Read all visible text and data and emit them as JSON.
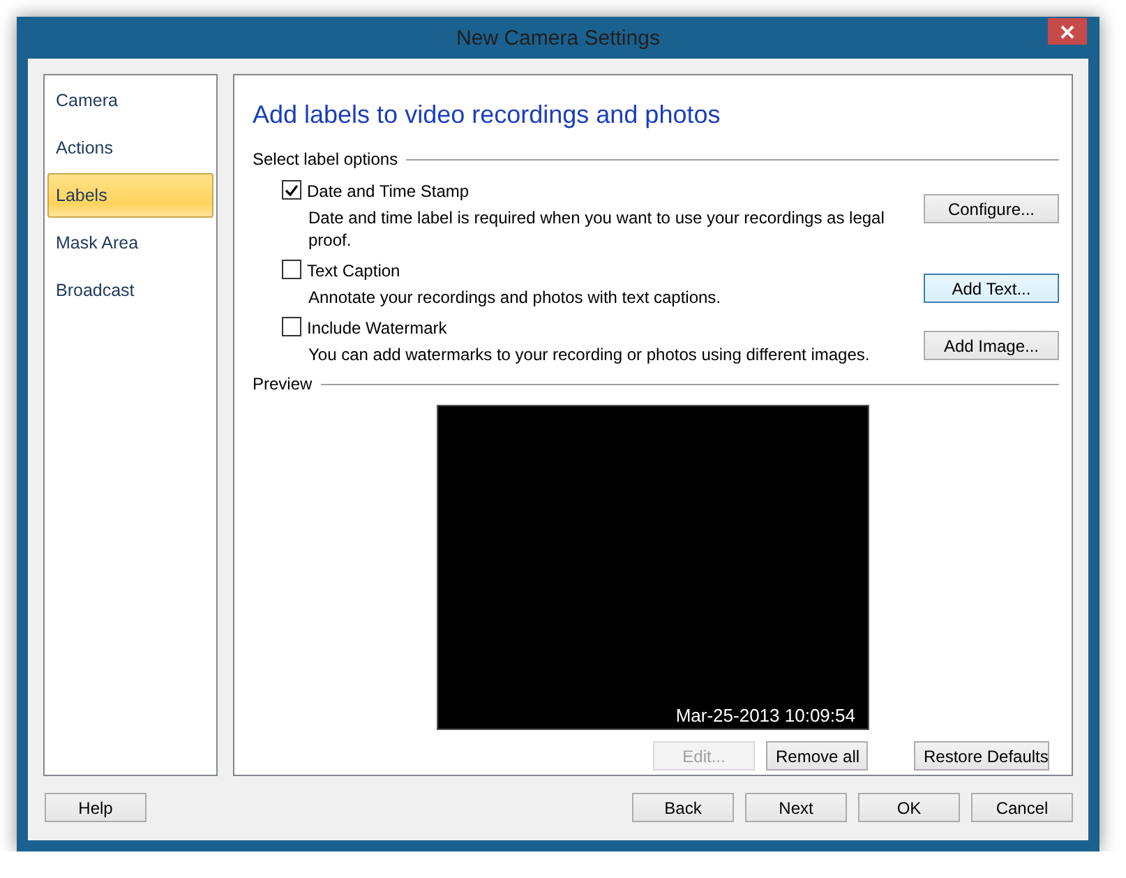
{
  "window": {
    "title": "New Camera Settings"
  },
  "sidebar": {
    "items": [
      {
        "label": "Camera",
        "selected": false
      },
      {
        "label": "Actions",
        "selected": false
      },
      {
        "label": "Labels",
        "selected": true
      },
      {
        "label": "Mask Area",
        "selected": false
      },
      {
        "label": "Broadcast",
        "selected": false
      }
    ]
  },
  "heading": "Add labels to video recordings and photos",
  "options_group": {
    "title": "Select label options",
    "options": [
      {
        "label": "Date and Time Stamp",
        "checked": true,
        "description": "Date and time label is required when you want to use your recordings as legal proof.",
        "button": {
          "label": "Configure...",
          "focused": false
        }
      },
      {
        "label": "Text Caption",
        "checked": false,
        "description": "Annotate your recordings and photos with text captions.",
        "button": {
          "label": "Add Text...",
          "focused": true
        }
      },
      {
        "label": "Include Watermark",
        "checked": false,
        "description": "You can add watermarks to your recording or photos using different images.",
        "button": {
          "label": "Add Image...",
          "focused": false
        }
      }
    ]
  },
  "preview": {
    "title": "Preview",
    "timestamp": "Mar-25-2013 10:09:54",
    "buttons": [
      {
        "label": "Edit...",
        "disabled": true
      },
      {
        "label": "Remove all",
        "disabled": false
      }
    ],
    "restore_button": "Restore Defaults"
  },
  "footer": {
    "help": "Help",
    "buttons": [
      "Back",
      "Next",
      "OK",
      "Cancel"
    ]
  }
}
